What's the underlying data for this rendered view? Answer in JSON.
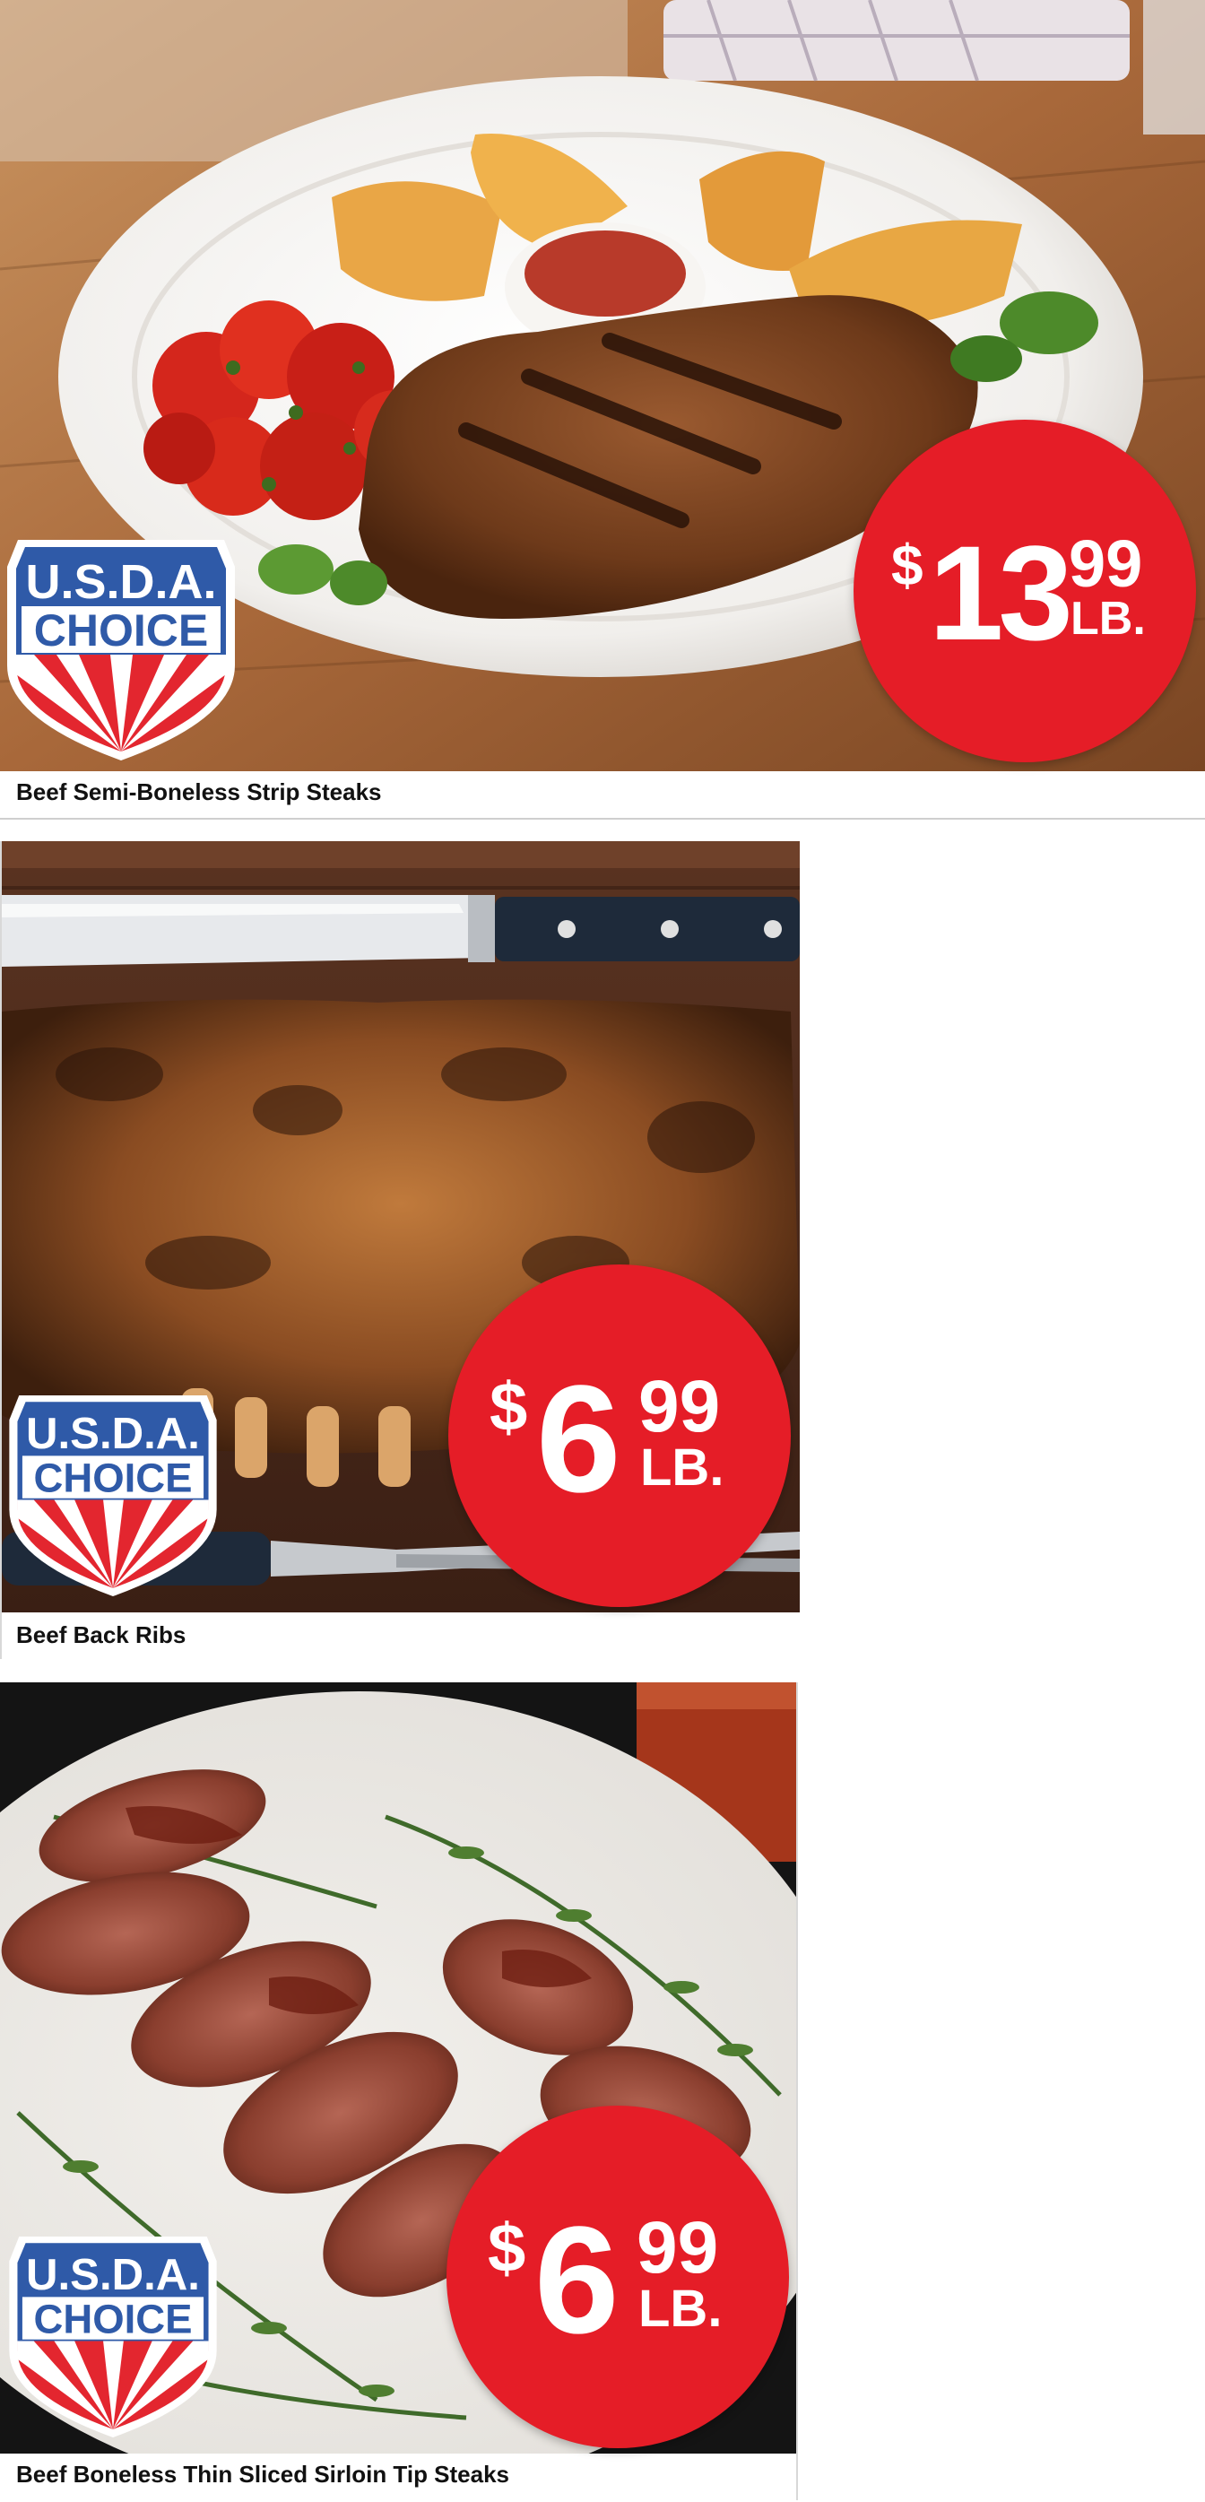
{
  "products": [
    {
      "name": "Beef Semi-Boneless Strip Steaks",
      "price": {
        "currency": "$",
        "dollars": "13",
        "cents": "99",
        "unit": "LB."
      },
      "badge": {
        "line1": "U.S.D.A.",
        "line2": "CHOICE"
      },
      "photo": "steak-plate-with-tomatoes-and-potato-wedges"
    },
    {
      "name": "Beef Back Ribs",
      "price": {
        "currency": "$",
        "dollars": "6",
        "cents": "99",
        "unit": "LB."
      },
      "badge": {
        "line1": "U.S.D.A.",
        "line2": "CHOICE"
      },
      "photo": "grilled-back-ribs-on-cutting-board-with-knife"
    },
    {
      "name": "Beef Boneless Thin Sliced Sirloin Tip Steaks",
      "price": {
        "currency": "$",
        "dollars": "6",
        "cents": "99",
        "unit": "LB."
      },
      "badge": {
        "line1": "U.S.D.A.",
        "line2": "CHOICE"
      },
      "photo": "sliced-sirloin-with-rosemary-on-plate"
    }
  ],
  "colors": {
    "badge_red": "#e51d27",
    "usda_blue": "#2f5aa8",
    "usda_red": "#e3262f"
  }
}
